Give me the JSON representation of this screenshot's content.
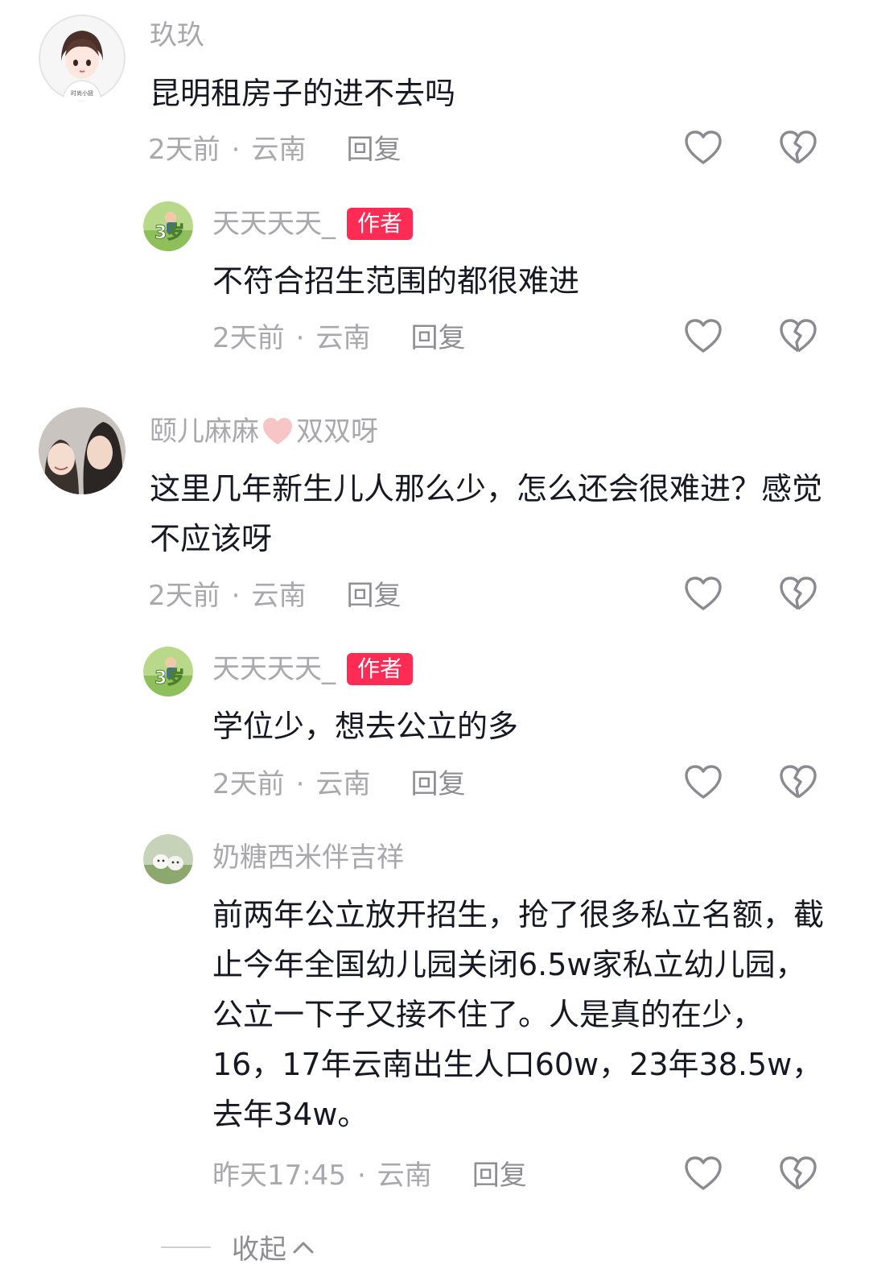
{
  "comments": [
    {
      "username": "玖玖",
      "text": "昆明租房子的进不去吗",
      "time": "2天前",
      "location": "云南",
      "reply_label": "回复",
      "avatar_text": "时尚小妞"
    },
    {
      "username": "天天天天_",
      "badge": "作者",
      "text": "不符合招生范围的都很难进",
      "time": "2天前",
      "location": "云南",
      "reply_label": "回复",
      "avatar_text": "3岁"
    },
    {
      "username_part1": "颐儿麻麻",
      "username_part2": "双双呀",
      "text": "这里几年新生儿人那么少，怎么还会很难进？感觉不应该呀",
      "time": "2天前",
      "location": "云南",
      "reply_label": "回复"
    },
    {
      "username": "天天天天_",
      "badge": "作者",
      "text": "学位少，想去公立的多",
      "time": "2天前",
      "location": "云南",
      "reply_label": "回复",
      "avatar_text": "3岁"
    },
    {
      "username": "奶糖西米伴吉祥",
      "text": "前两年公立放开招生，抢了很多私立名额，截止今年全国幼儿园关闭6.5w家私立幼儿园，公立一下子又接不住了。人是真的在少，16，17年云南出生人口60w，23年38.5w，去年34w。",
      "time": "昨天17:45",
      "location": "云南",
      "reply_label": "回复"
    }
  ],
  "separator": "·",
  "collapse_label": "收起",
  "colors": {
    "badge": "#fe2c55",
    "muted": "#a8a8ad",
    "text": "#161823",
    "heart_pink": "#f7c5c5"
  },
  "icons": [
    "heart-outline-icon",
    "broken-heart-icon",
    "chevron-up-icon"
  ]
}
